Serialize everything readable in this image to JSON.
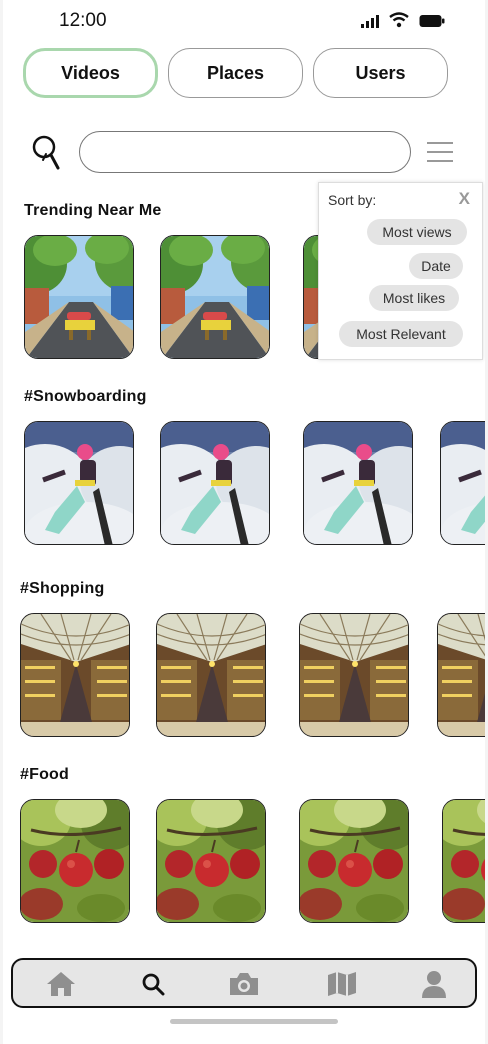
{
  "status_bar": {
    "time": "12:00"
  },
  "tabs": [
    {
      "label": "Videos",
      "active": true
    },
    {
      "label": "Places",
      "active": false
    },
    {
      "label": "Users",
      "active": false
    }
  ],
  "search": {
    "placeholder": ""
  },
  "sort_panel": {
    "title": "Sort by:",
    "close_label": "X",
    "options": [
      "Most views",
      "Date",
      "Most likes",
      "Most Relevant"
    ]
  },
  "sections": [
    {
      "title": "Trending Near Me",
      "thumbnail": "street-scene",
      "count": 3
    },
    {
      "title": "#Snowboarding",
      "thumbnail": "snowboarder",
      "count": 4
    },
    {
      "title": "#Shopping",
      "thumbnail": "shopping-mall",
      "count": 4
    },
    {
      "title": "#Food",
      "thumbnail": "apples",
      "count": 4
    }
  ],
  "bottom_nav": {
    "items": [
      "home-icon",
      "search-icon",
      "camera-icon",
      "map-icon",
      "profile-icon"
    ],
    "active": "search-icon"
  },
  "colors": {
    "active_tab_border": "#a9d7ad",
    "nav_background": "#e6e6e6",
    "chip_background": "#e4e4e4"
  }
}
